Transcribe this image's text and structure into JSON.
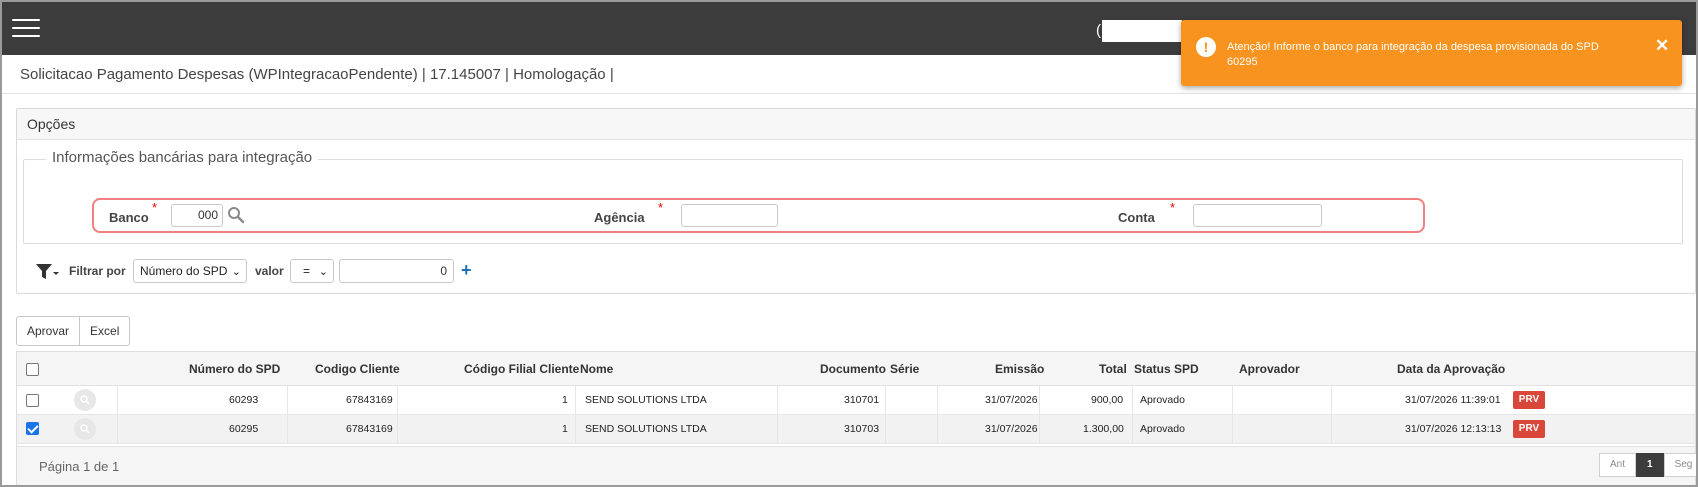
{
  "header": {
    "title": "Solicitacao Pagamento Despesas (WPIntegracaoPendente) | 17.145007 | Homologação |",
    "top_paren": "("
  },
  "options": {
    "title": "Opções",
    "bank_legend": "Informações bancárias para integração",
    "banco_label": "Banco",
    "banco_value": "000",
    "agencia_label": "Agência",
    "agencia_value": "",
    "conta_label": "Conta",
    "conta_value": "",
    "required_mark": "*"
  },
  "filter": {
    "label": "Filtrar por",
    "field_selected": "Número do SPD",
    "valor_label": "valor",
    "operator_selected": "=",
    "value": "0",
    "add_symbol": "+"
  },
  "actions": {
    "approve_label": "Aprovar",
    "excel_label": "Excel"
  },
  "table": {
    "columns": [
      "Número do SPD",
      "Codigo Cliente",
      "Código Filial Cliente",
      "Nome",
      "Documento",
      "Série",
      "Emissão",
      "Total",
      "Status SPD",
      "Aprovador",
      "Data da Aprovação"
    ],
    "rows": [
      {
        "checked": false,
        "numero_spd": "60293",
        "codigo_cliente": "67843169",
        "codigo_filial": "1",
        "nome": "SEND SOLUTIONS LTDA",
        "documento": "310701",
        "serie": "",
        "emissao": "31/07/2026",
        "total": "900,00",
        "status": "Aprovado",
        "aprovador": "",
        "data_aprovacao": "31/07/2026 11:39:01",
        "action": "PRV"
      },
      {
        "checked": true,
        "numero_spd": "60295",
        "codigo_cliente": "67843169",
        "codigo_filial": "1",
        "nome": "SEND SOLUTIONS LTDA",
        "documento": "310703",
        "serie": "",
        "emissao": "31/07/2026",
        "total": "1.300,00",
        "status": "Aprovado",
        "aprovador": "",
        "data_aprovacao": "31/07/2026 12:13:13",
        "action": "PRV"
      }
    ]
  },
  "pager": {
    "text": "Página 1 de 1",
    "prev": "Ant",
    "current": "1",
    "next": "Seg"
  },
  "toast": {
    "message": "Atenção! Informe o banco para integração da despesa provisionada do SPD 60295",
    "icon": "!",
    "close": "✕",
    "color": "#f7931e"
  },
  "colors": {
    "topbar": "#3c3c3c",
    "required": "#ee0000",
    "prv_button": "#d9473a",
    "highlight_border": "#f08080"
  }
}
